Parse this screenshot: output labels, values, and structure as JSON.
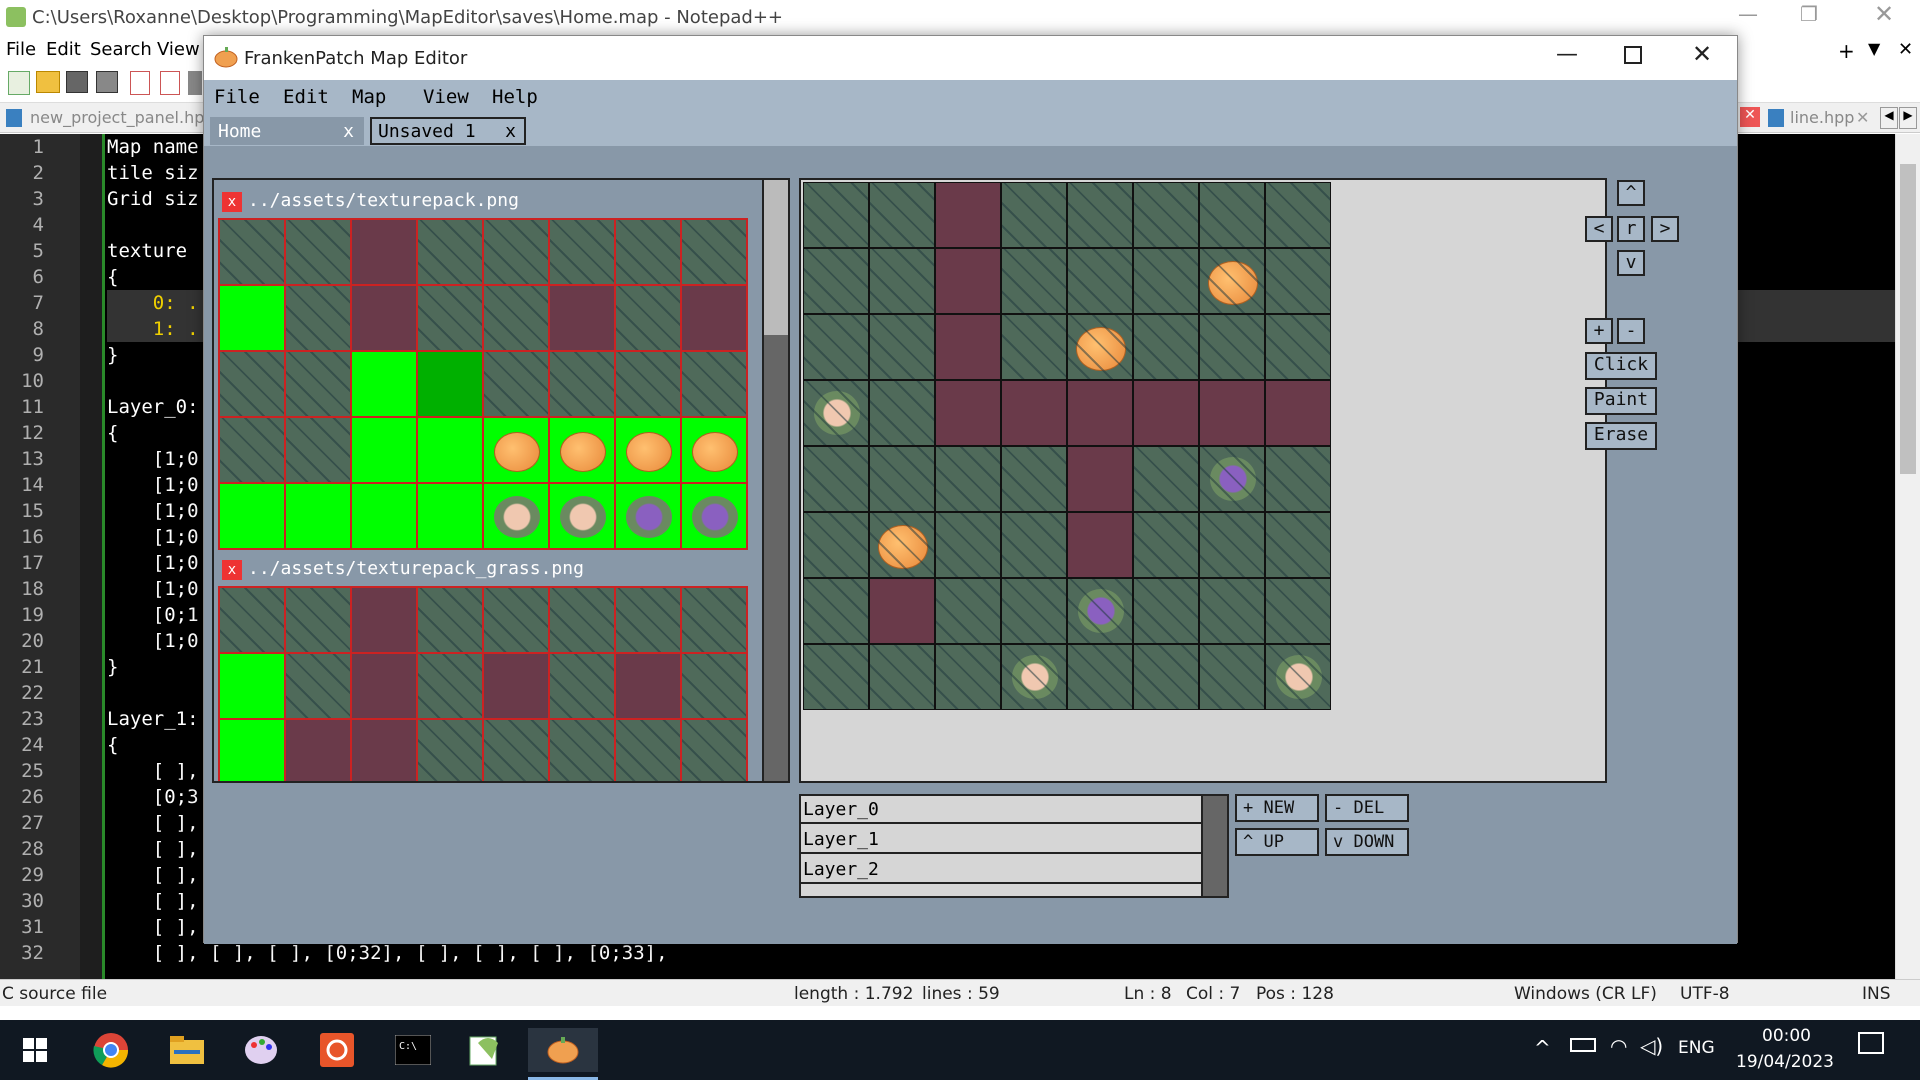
{
  "npp": {
    "title": "C:\\Users\\Roxanne\\Desktop\\Programming\\MapEditor\\saves\\Home.map - Notepad++",
    "menu": [
      "File",
      "Edit",
      "Search",
      "View"
    ],
    "tabs": {
      "left": "new_project_panel.hpp",
      "right": "line.hpp"
    },
    "line_numbers": [
      "1",
      "2",
      "3",
      "4",
      "5",
      "6",
      "7",
      "8",
      "9",
      "10",
      "11",
      "12",
      "13",
      "14",
      "15",
      "16",
      "17",
      "18",
      "19",
      "20",
      "21",
      "22",
      "23",
      "24",
      "25",
      "26",
      "27",
      "28",
      "29",
      "30",
      "31",
      "32"
    ],
    "code_lines": [
      "Map name",
      "tile siz",
      "Grid siz",
      "",
      "texture",
      "{",
      "    0: .",
      "    1: .",
      "}",
      "",
      "Layer_0:",
      "{",
      "    [1;0",
      "    [1;0",
      "    [1;0",
      "    [1;0",
      "    [1;0",
      "    [1;0",
      "    [0;1",
      "    [1;0",
      "}",
      "",
      "Layer_1:",
      "{",
      "    [ ],",
      "    [0;3",
      "    [ ],",
      "    [ ],",
      "    [ ],",
      "    [ ],",
      "    [ ],",
      "    [ ], [ ], [ ], [0;32], [ ], [ ], [ ], [0;33],"
    ],
    "status": {
      "type": "C source file",
      "length": "length : 1.792",
      "lines": "lines : 59",
      "ln": "Ln : 8",
      "col": "Col : 7",
      "pos": "Pos : 128",
      "eol": "Windows (CR LF)",
      "enc": "UTF-8",
      "mode": "INS"
    }
  },
  "editor": {
    "title": "FrankenPatch Map Editor",
    "menu": [
      "File",
      "Edit",
      "Map",
      "View",
      "Help"
    ],
    "tabs": [
      {
        "label": "Home",
        "close": "x"
      },
      {
        "label": "Unsaved 1",
        "close": "x"
      }
    ],
    "textures": [
      {
        "close": "x",
        "path": "../assets/texturepack.png"
      },
      {
        "close": "x",
        "path": "../assets/texturepack_grass.png"
      }
    ],
    "nav": {
      "up": "^",
      "left": "<",
      "reset": "r",
      "right": ">",
      "down": "v",
      "zoom_in": "+",
      "zoom_out": "-",
      "click": "Click",
      "paint": "Paint",
      "erase": "Erase"
    },
    "layers": [
      "Layer_0",
      "Layer_1",
      "Layer_2"
    ],
    "layer_buttons": {
      "new": "+ NEW",
      "del": "- DEL",
      "up": "^ UP",
      "down": "v DOWN"
    }
  },
  "taskbar": {
    "lang": "ENG",
    "time": "00:00",
    "date": "19/04/2023"
  },
  "colors": {
    "grass": "#4f6a5a",
    "dirt": "#6a3a4a",
    "green": "#00ff00",
    "panel": "#8898a8",
    "button": "#a7b7c7"
  }
}
